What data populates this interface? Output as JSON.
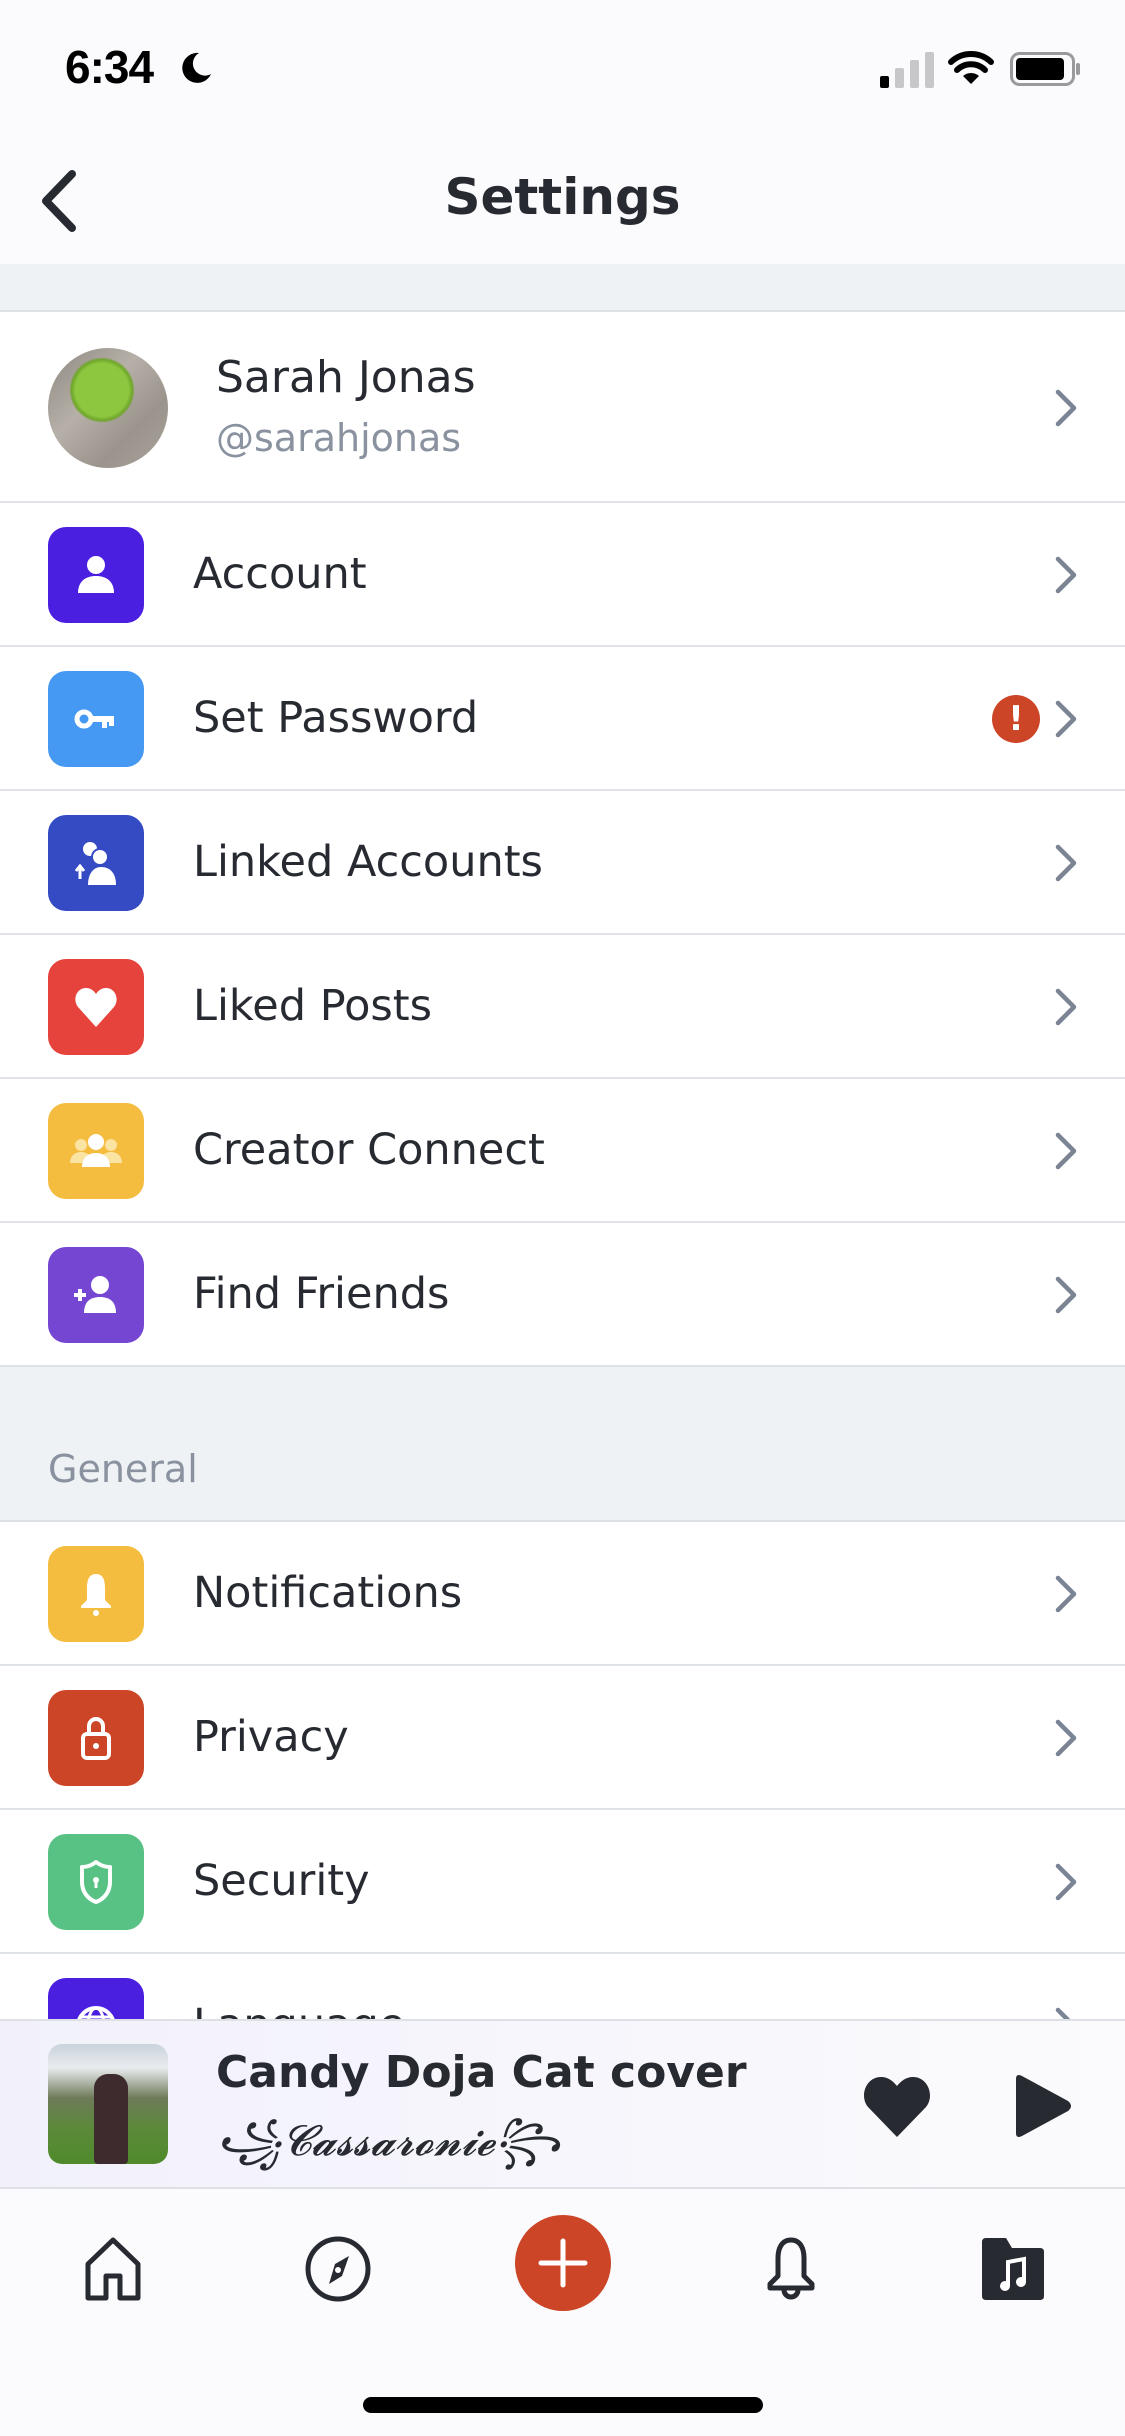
{
  "status_bar": {
    "time": "6:34",
    "focus_icon": "moon-icon",
    "signal_bars_filled": 1,
    "signal_bars_total": 4,
    "wifi": "wifi-icon",
    "battery_level": 0.85
  },
  "header": {
    "title": "Settings",
    "back_icon": "chevron-left-icon"
  },
  "profile": {
    "name": "Sarah Jonas",
    "handle": "@sarahjonas",
    "avatar": "green apple on wooden table"
  },
  "account_section": {
    "items": [
      {
        "label": "Account",
        "icon": "person-icon",
        "color": "#4a1fe0",
        "badge": null
      },
      {
        "label": "Set Password",
        "icon": "key-icon",
        "color": "#4599f2",
        "badge": "!"
      },
      {
        "label": "Linked Accounts",
        "icon": "linked-users-icon",
        "color": "#344bc3",
        "badge": null
      },
      {
        "label": "Liked Posts",
        "icon": "heart-icon",
        "color": "#e5433b",
        "badge": null
      },
      {
        "label": "Creator Connect",
        "icon": "group-icon",
        "color": "#f4bd40",
        "badge": null
      },
      {
        "label": "Find Friends",
        "icon": "add-person-icon",
        "color": "#7446d2",
        "badge": null
      }
    ]
  },
  "general_section": {
    "title": "General",
    "items": [
      {
        "label": "Notifications",
        "icon": "bell-icon",
        "color": "#f4bd40"
      },
      {
        "label": "Privacy",
        "icon": "lock-icon",
        "color": "#cc4527"
      },
      {
        "label": "Security",
        "icon": "shield-icon",
        "color": "#58c285"
      },
      {
        "label": "Language",
        "icon": "globe-icon",
        "color": "#4a1fe0"
      }
    ]
  },
  "mini_player": {
    "title": "Candy Doja Cat cover",
    "artist": "꧁𝓒𝓪𝓼𝓼𝓪𝓻𝓸𝓷𝓲𝓮꧂",
    "liked": true,
    "state": "paused"
  },
  "tab_bar": {
    "tabs": [
      {
        "name": "home",
        "icon": "home-icon"
      },
      {
        "name": "explore",
        "icon": "compass-icon"
      },
      {
        "name": "create",
        "icon": "plus-icon"
      },
      {
        "name": "notifications",
        "icon": "bell-icon"
      },
      {
        "name": "library",
        "icon": "music-folder-icon",
        "active": true
      }
    ]
  },
  "colors": {
    "accent": "#cc4527",
    "text_primary": "#272a31",
    "text_secondary": "#8a92a0",
    "chevron": "#7b8494",
    "section_bg": "#eff2f5"
  }
}
